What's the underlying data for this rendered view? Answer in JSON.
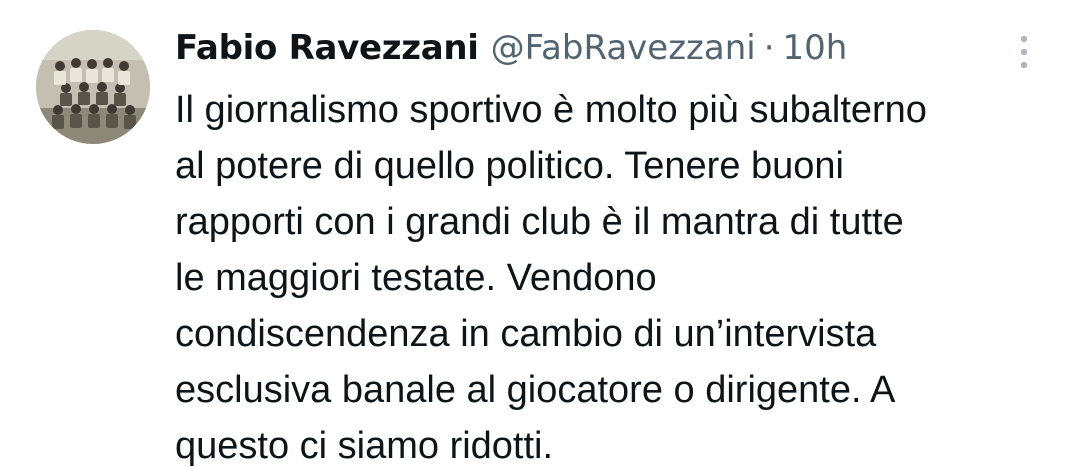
{
  "tweet": {
    "author": {
      "name": "Fabio Ravezzani",
      "handle": "@FabRavezzani"
    },
    "separator": "·",
    "time": "10h",
    "icons": {
      "avatar": "team-photo-avatar",
      "more": "more-vertical-icon"
    },
    "text_lines": [
      "Il giornalismo sportivo è molto più subalterno",
      "al potere di quello politico. Tenere buoni",
      "rapporti con i grandi club è il mantra di tutte",
      "le maggiori testate. Vendono",
      "condiscendenza in cambio di un’intervista",
      "esclusiva banale al giocatore o dirigente. A",
      "questo ci siamo ridotti."
    ],
    "colors": {
      "text": "#0f1419",
      "secondary": "#536471",
      "icon": "#b0b6bb"
    }
  }
}
